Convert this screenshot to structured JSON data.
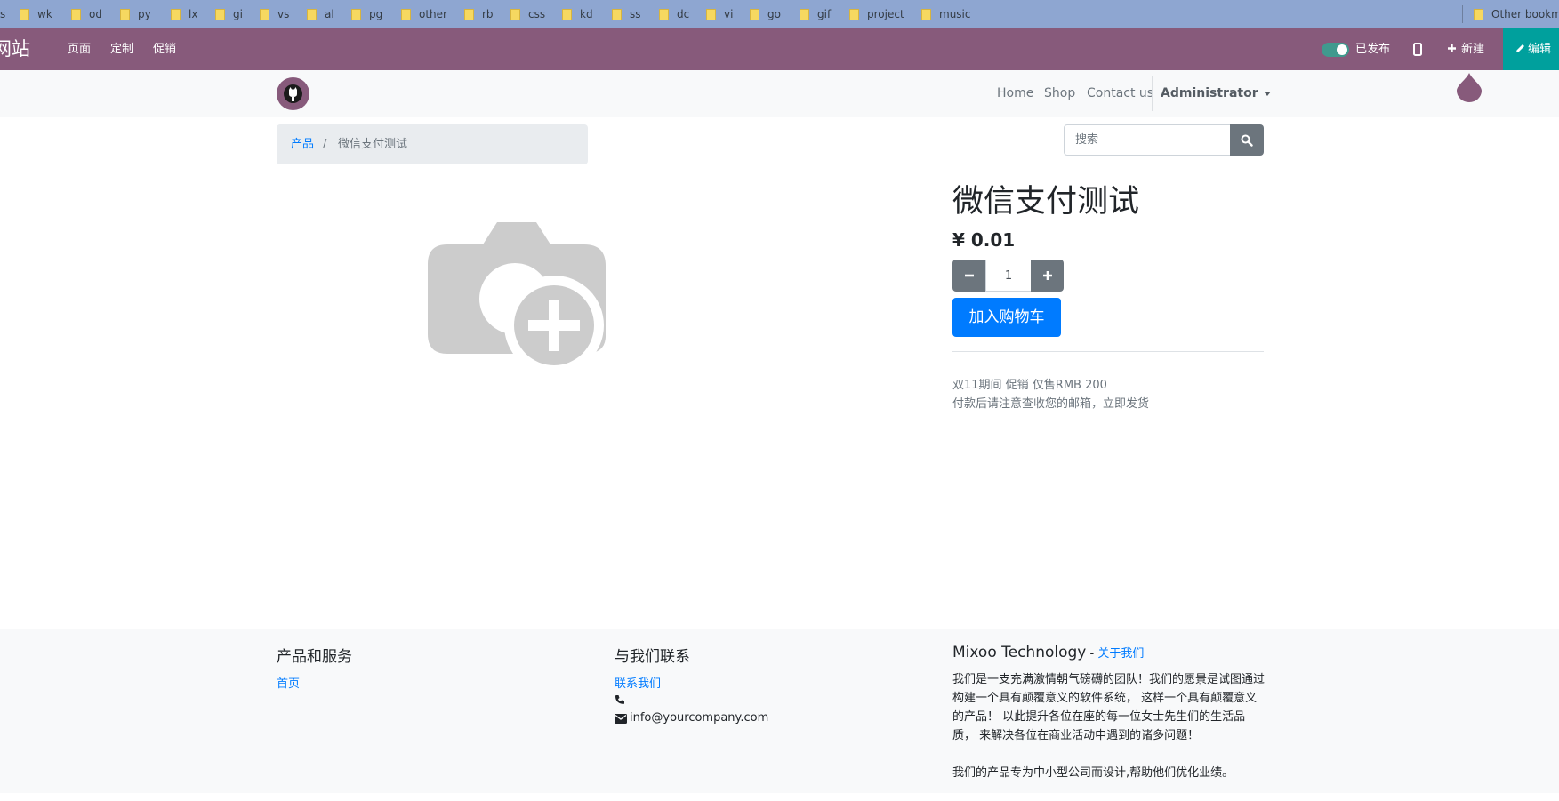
{
  "bookmarks": {
    "items": [
      "s",
      "wk",
      "od",
      "py",
      "lx",
      "gi",
      "vs",
      "al",
      "pg",
      "other",
      "rb",
      "css",
      "kd",
      "ss",
      "dc",
      "vi",
      "go",
      "gif",
      "project",
      "music"
    ],
    "other": "Other bookm"
  },
  "adminbar": {
    "brand": "网站",
    "menu": [
      "页面",
      "定制",
      "促销"
    ],
    "published_label": "已发布",
    "new_label": "新建",
    "edit_label": "编辑"
  },
  "navbar": {
    "links": [
      "Home",
      "Shop",
      "Contact us"
    ],
    "user": "Administrator"
  },
  "breadcrumb": {
    "parent": "产品",
    "separator": "/",
    "current": "微信支付测试"
  },
  "search": {
    "placeholder": "搜索"
  },
  "product": {
    "title": "微信支付测试",
    "price": "¥ 0.01",
    "quantity": "1",
    "add_to_cart": "加入购物车",
    "description": [
      "双11期间 促销 仅售RMB 200",
      "付款后请注意查收您的邮箱，立即发货"
    ]
  },
  "footer": {
    "products_heading": "产品和服务",
    "products_link": "首页",
    "contact_heading": "与我们联系",
    "contact_link": "联系我们",
    "email": "info@yourcompany.com",
    "company_name": "Mixoo Technology",
    "company_sep": " - ",
    "about_link": "关于我们",
    "about_p1": "我们是一支充满激情朝气磅礴的团队！我们的愿景是试图通过构建一个具有颠覆意义的软件系统， 这样一个具有颠覆意义的产品！ 以此提升各位在座的每一位女士先生们的生活品质， 来解决各位在商业活动中遇到的诸多问题！",
    "about_p2": "我们的产品专为中小型公司而设计,帮助他们优化业绩。"
  },
  "colors": {
    "brand": "#875a7b",
    "edit": "#00a09d",
    "primary": "#007bff",
    "secondary": "#6c757d"
  }
}
